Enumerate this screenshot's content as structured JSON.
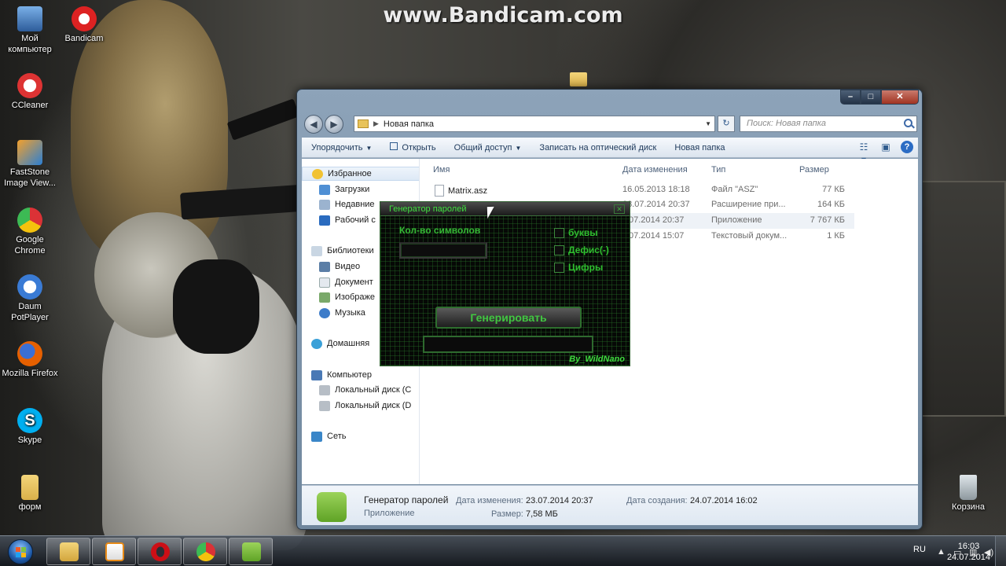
{
  "watermark": "www.Bandicam.com",
  "desktop_icons": [
    {
      "label": "Мой компьютер",
      "icon": "computer-icon",
      "color": "#3d6fb5"
    },
    {
      "label": "Bandicam",
      "icon": "bandicam-icon",
      "color": "#d22"
    },
    {
      "label": "CCleaner",
      "icon": "ccleaner-icon",
      "color": "#c33"
    },
    {
      "label": "FastStone Image View...",
      "icon": "faststone-icon",
      "color": "#2a7fd4"
    },
    {
      "label": "Google Chrome",
      "icon": "chrome-icon",
      "color": "#e6b800"
    },
    {
      "label": "Daum PotPlayer",
      "icon": "potplayer-icon",
      "color": "#3a7bd5"
    },
    {
      "label": "Mozilla Firefox",
      "icon": "firefox-icon",
      "color": "#e66000"
    },
    {
      "label": "Skype",
      "icon": "skype-icon",
      "color": "#00aff0"
    },
    {
      "label": "форм",
      "icon": "folder-icon",
      "color": "#e8c35a"
    },
    {
      "label": "Корзина",
      "icon": "recycle-bin-icon",
      "color": "#9aa"
    }
  ],
  "explorer": {
    "address": "Новая папка",
    "search_placeholder": "Поиск: Новая папка",
    "toolbar": {
      "organize": "Упорядочить",
      "open": "Открыть",
      "share": "Общий доступ",
      "burn": "Записать на оптический диск",
      "new_folder": "Новая папка"
    },
    "nav": {
      "favorites": "Избранное",
      "downloads": "Загрузки",
      "recent": "Недавние",
      "desktop": "Рабочий с",
      "libraries": "Библиотеки",
      "video": "Видео",
      "documents": "Документ",
      "images": "Изображе",
      "music": "Музыка",
      "homegroup": "Домашняя",
      "computer": "Компьютер",
      "disk_c": "Локальный диск (C",
      "disk_d": "Локальный диск (D",
      "network": "Сеть"
    },
    "columns": {
      "name": "Имя",
      "date": "Дата изменения",
      "type": "Тип",
      "size": "Размер"
    },
    "files": [
      {
        "name": "Matrix.asz",
        "date": "16.05.2013 18:18",
        "type": "Файл \"ASZ\"",
        "size": "77 КБ"
      },
      {
        "name": "",
        "date": "23.07.2014 20:37",
        "type": "Расширение при...",
        "size": "164 КБ"
      },
      {
        "name": "",
        "date": ".07.2014 20:37",
        "type": "Приложение",
        "size": "7 767 КБ"
      },
      {
        "name": "",
        "date": ".07.2014 15:07",
        "type": "Текстовый докум...",
        "size": "1 КБ"
      }
    ],
    "details": {
      "name": "Генератор паролей",
      "kind": "Приложение",
      "modified_label": "Дата изменения:",
      "modified_value": "23.07.2014 20:37",
      "size_label": "Размер:",
      "size_value": "7,58 МБ",
      "created_label": "Дата создания:",
      "created_value": "24.07.2014 16:02"
    }
  },
  "generator": {
    "title": "Генератор паролей",
    "count_label": "Кол-во символов",
    "opt_letters": "буквы",
    "opt_hyphen": "Дефис(-)",
    "opt_digits": "Цифры",
    "generate_button": "Генерировать",
    "author": "By_WildNano"
  },
  "taskbar": {
    "lang": "RU",
    "time": "16:03",
    "date": "24.07.2014"
  }
}
